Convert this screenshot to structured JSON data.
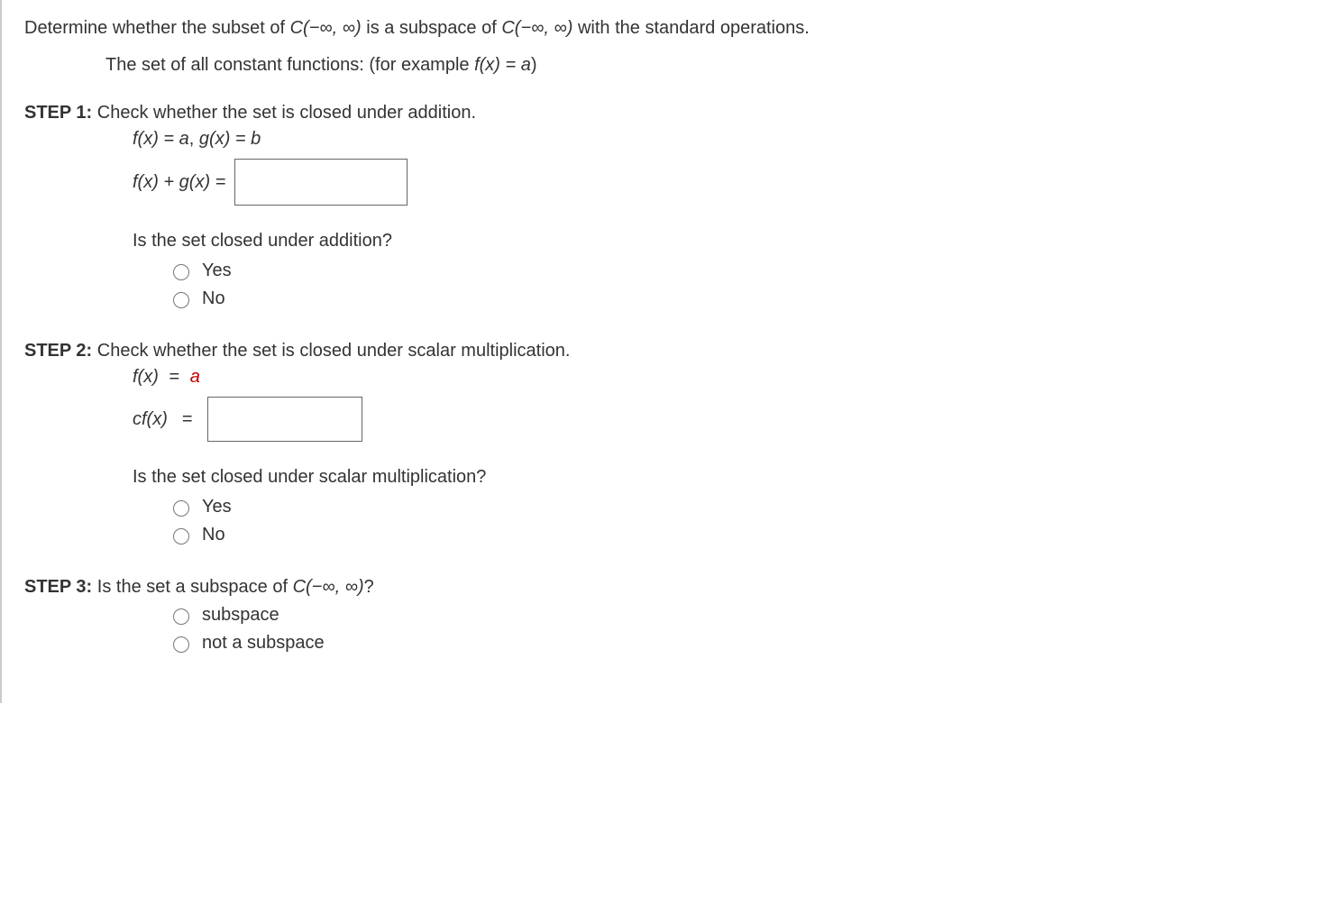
{
  "question": {
    "prompt_prefix": "Determine whether the subset of ",
    "cset1": "C(−∞, ∞)",
    "prompt_mid": " is a subspace of ",
    "cset2": "C(−∞, ∞)",
    "prompt_suffix": " with the standard operations.",
    "subset_desc_prefix": "The set of all constant functions: (for example ",
    "subset_example_f": "f(x) = a",
    "subset_desc_suffix": ")"
  },
  "step1": {
    "label": "STEP 1:",
    "heading": " Check whether the set is closed under addition.",
    "given_f": "f(x) = a",
    "given_sep": ", ",
    "given_g": "g(x) = b",
    "expr_lhs": "f(x) + g(x) = ",
    "subq": "Is the set closed under addition?",
    "opt_yes": "Yes",
    "opt_no": "No"
  },
  "step2": {
    "label": "STEP 2:",
    "heading": " Check whether the set is closed under scalar multiplication.",
    "given_f_lhs": "f(x)",
    "given_f_rhs": "a",
    "expr_lhs_cf": "cf(x)",
    "subq": "Is the set closed under scalar multiplication?",
    "opt_yes": "Yes",
    "opt_no": "No"
  },
  "step3": {
    "label": "STEP 3:",
    "heading_prefix": " Is the set a subspace of ",
    "cset": "C(−∞, ∞)",
    "heading_suffix": "?",
    "opt_subspace": "subspace",
    "opt_not_subspace": "not a subspace"
  }
}
